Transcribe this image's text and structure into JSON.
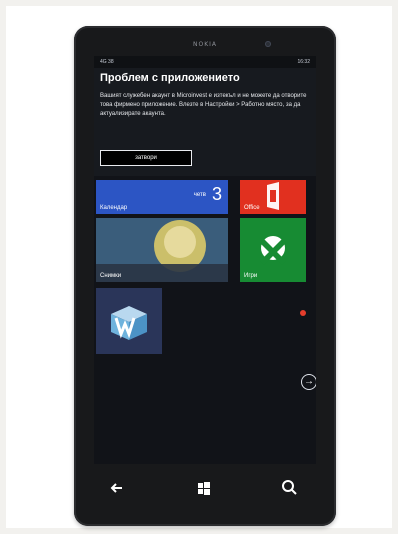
{
  "device": {
    "brand": "NOKIA"
  },
  "status_bar": {
    "left": "4G 38",
    "right": "16:32"
  },
  "dialog": {
    "title": "Проблем с приложението",
    "message": "Вашият служебен акаунт в Microinvest е изтекъл и не можете да отворите това фирмено приложение. Влезте в Настройки > Работно място, за да актуализирате акаунта.",
    "button_label": "затвори"
  },
  "tiles": {
    "calendar": {
      "label": "Календар",
      "weekday": "четв",
      "day": "3"
    },
    "office": {
      "label": "Office"
    },
    "photos": {
      "label": "Снимки"
    },
    "games": {
      "label": "Игри"
    }
  },
  "colors": {
    "calendar": "#2c55c4",
    "office": "#e1301f",
    "games": "#178b33",
    "dialog_bg": "#171a1f"
  },
  "icons": {
    "back": "back-arrow-icon",
    "home": "windows-icon",
    "search": "search-icon",
    "next": "arrow-right-icon"
  }
}
